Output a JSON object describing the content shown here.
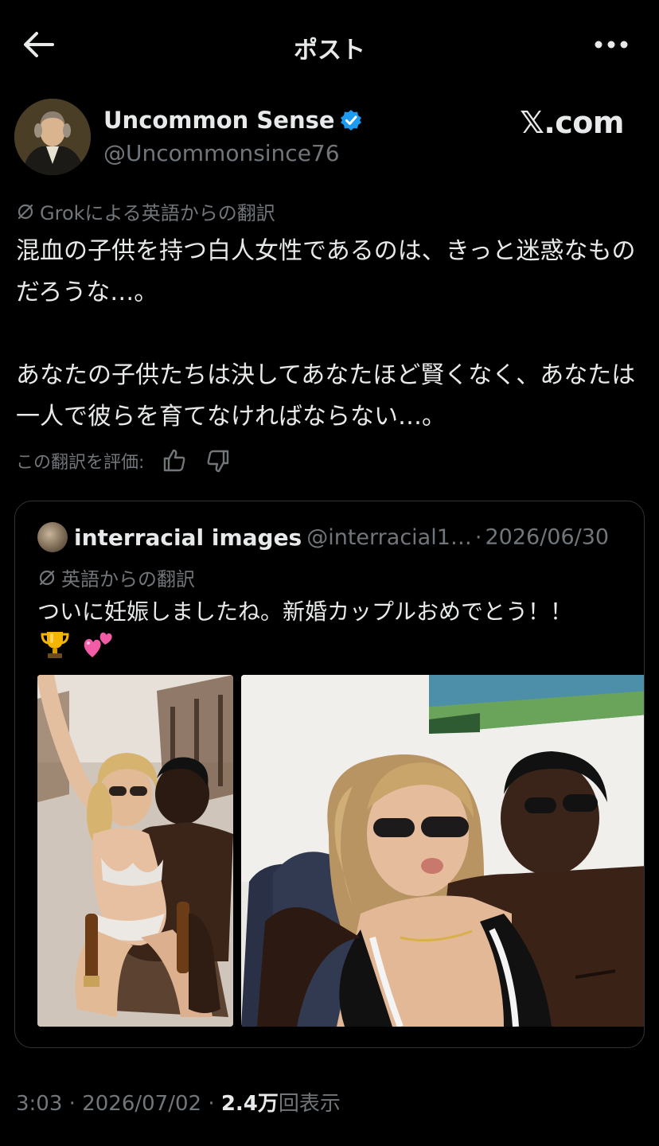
{
  "header": {
    "back_icon": "arrow-left-icon",
    "title": "ポスト",
    "more_icon": "more-horizontal-icon"
  },
  "author": {
    "name": "Uncommon Sense",
    "handle": "@Uncommonsince76",
    "verified_icon": "verified-badge-icon",
    "watermark": "𝕏.com"
  },
  "translation": {
    "icon": "translate-icon",
    "label": "Grokによる英語からの翻訳"
  },
  "post": {
    "paragraph1": "混血の子供を持つ白人女性であるのは、きっと迷惑なものだろうな…。",
    "paragraph2": "あなたの子供たちは決してあなたほど賢くなく、あなたは一人で彼らを育てなければならない…。"
  },
  "rating": {
    "label": "この翻訳を評価:",
    "thumb_up_icon": "thumbs-up-icon",
    "thumb_down_icon": "thumbs-down-icon"
  },
  "quote": {
    "name": "interracial images",
    "handle": "@interracial1…",
    "separator": "·",
    "date": "2026/06/30",
    "translation_label": "英語からの翻訳",
    "text": "ついに妊娠しましたね。新婚カップルおめでとう！！",
    "emoji": [
      "trophy-icon",
      "two-hearts-icon"
    ]
  },
  "meta": {
    "time": "3:03",
    "separator": "·",
    "date": "2026/07/02",
    "views_count": "2.4万",
    "views_label": "回表示"
  },
  "colors": {
    "background": "#000000",
    "text": "#e7e9ea",
    "secondary": "#71767b",
    "border": "#2f3336",
    "verified": "#1d9bf0"
  }
}
